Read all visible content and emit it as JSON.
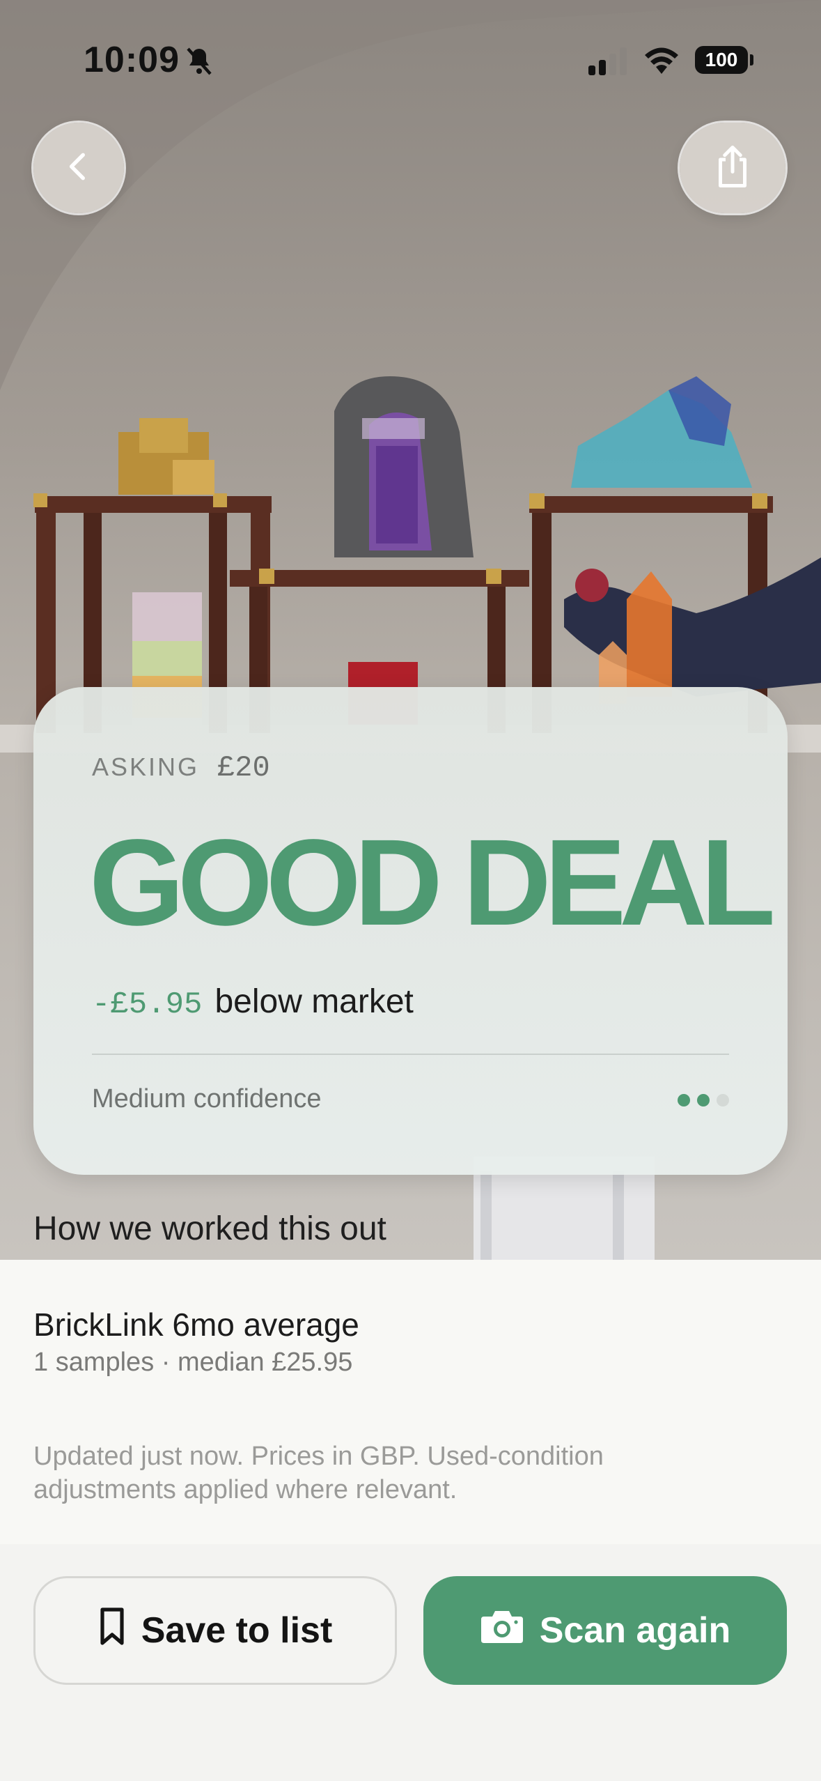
{
  "status_bar": {
    "time": "10:09",
    "battery": "100"
  },
  "card": {
    "asking_label": "ASKING",
    "asking_value": "£20",
    "verdict": "GOOD DEAL",
    "difference": "-£5.95",
    "difference_text": "below market",
    "confidence_label": "Medium confidence",
    "confidence_level": 2,
    "confidence_max": 3
  },
  "explanation": {
    "title": "How we worked this out",
    "source_name": "BrickLink 6mo average",
    "source_meta": "1 samples · median £25.95",
    "footnote": "Updated just now. Prices in GBP. Used-condition adjustments applied where relevant."
  },
  "actions": {
    "save_label": "Save to list",
    "scan_label": "Scan again"
  },
  "colors": {
    "accent": "#4e9a72"
  }
}
